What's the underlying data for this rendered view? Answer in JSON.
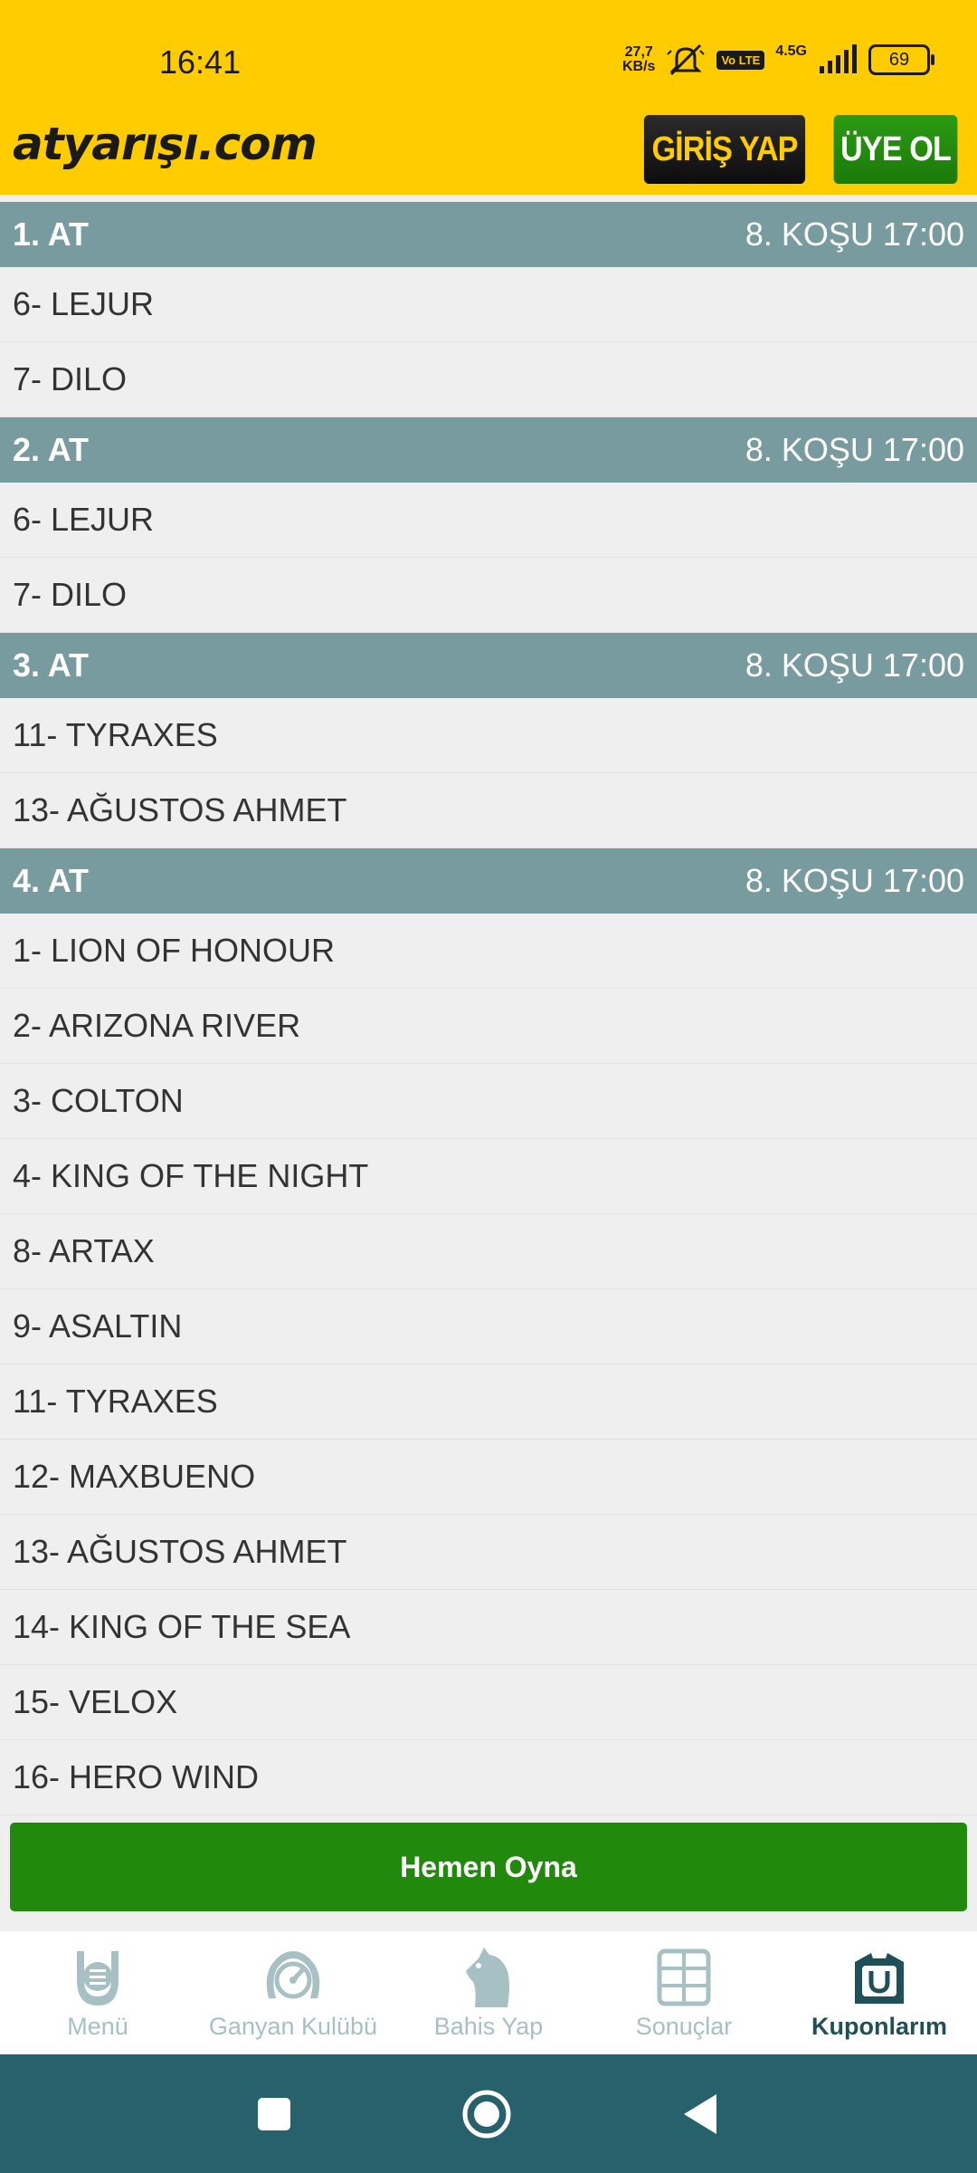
{
  "status_bar": {
    "time": "16:41",
    "net_speed_value": "27,7",
    "net_speed_unit": "KB/s",
    "volte": "Vo LTE",
    "network_type": "4.5G",
    "battery": "69"
  },
  "header": {
    "logo": "atyarışı.com",
    "login_label": "GİRİŞ YAP",
    "register_label": "ÜYE OL"
  },
  "sections": [
    {
      "title": "1. AT",
      "race": "8. KOŞU 17:00",
      "horses": [
        "6- LEJUR",
        "7- DILO"
      ]
    },
    {
      "title": "2. AT",
      "race": "8. KOŞU 17:00",
      "horses": [
        "6- LEJUR",
        "7- DILO"
      ]
    },
    {
      "title": "3. AT",
      "race": "8. KOŞU 17:00",
      "horses": [
        "11- TYRAXES",
        "13- AĞUSTOS AHMET"
      ]
    },
    {
      "title": "4. AT",
      "race": "8. KOŞU 17:00",
      "horses": [
        "1- LION OF HONOUR",
        "2- ARIZONA RIVER",
        "3- COLTON",
        "4- KING OF THE NIGHT",
        "8- ARTAX",
        "9- ASALTIN",
        "11- TYRAXES",
        "12- MAXBUENO",
        "13- AĞUSTOS AHMET",
        "14- KING OF THE SEA",
        "15- VELOX",
        "16- HERO WIND"
      ]
    }
  ],
  "play_button": "Hemen Oyna",
  "bottom_nav": [
    {
      "label": "Menü",
      "icon": "horseshoe-menu-icon",
      "active": false
    },
    {
      "label": "Ganyan Kulübü",
      "icon": "horseshoe-gauge-icon",
      "active": false
    },
    {
      "label": "Bahis Yap",
      "icon": "horse-head-icon",
      "active": false
    },
    {
      "label": "Sonuçlar",
      "icon": "results-board-icon",
      "active": false
    },
    {
      "label": "Kuponlarım",
      "icon": "coupons-icon",
      "active": true
    }
  ],
  "colors": {
    "brand_yellow": "#ffcc00",
    "section_header": "#789b9f",
    "play_green": "#218a0d",
    "nav_active": "#1f4f57",
    "nav_inactive": "#a7c0c3",
    "android_bar": "#27616b"
  }
}
